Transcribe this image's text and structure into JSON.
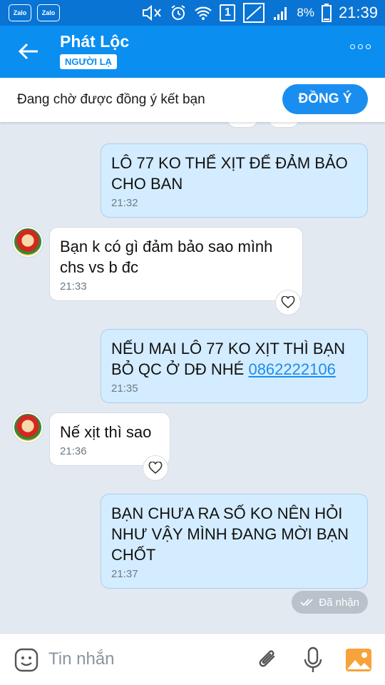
{
  "status_bar": {
    "left_apps": [
      "Zalo",
      "Zalo"
    ],
    "sim_label": "1",
    "battery": "8%",
    "time": "21:39"
  },
  "header": {
    "contact_name": "Phát Lộc",
    "badge": "NGƯỜI LẠ"
  },
  "friend_request": {
    "text": "Đang chờ được đồng ý kết bạn",
    "accept_label": "ĐỒNG Ý"
  },
  "messages": [
    {
      "sender": "me",
      "text": "LÔ 77 KO THỂ XỊT ĐỂ ĐẢM BẢO CHO BAN",
      "time": "21:32"
    },
    {
      "sender": "them",
      "text": "Bạn k có gì đảm bảo sao mình chs vs b đc",
      "time": "21:33"
    },
    {
      "sender": "me",
      "text": "NẾU MAI LÔ 77 KO XỊT THÌ BẠN BỎ QC Ở DĐ NHÉ",
      "link": "0862222106",
      "time": "21:35"
    },
    {
      "sender": "them",
      "text": "Nế xịt thì sao",
      "time": "21:36"
    },
    {
      "sender": "me",
      "text": "BẠN CHƯA RA SỐ KO NÊN HỎI NHƯ VẬY MÌNH ĐANG MỜI BẠN CHỐT",
      "time": "21:37"
    }
  ],
  "received_status": "Đã nhận",
  "input": {
    "placeholder": "Tin nhắn"
  },
  "colors": {
    "header": "#0a8ef0",
    "status_bar": "#0a74d4",
    "my_bubble": "#d4ecff",
    "chat_bg": "#e2e9f1",
    "accent": "#1a8ef0"
  }
}
